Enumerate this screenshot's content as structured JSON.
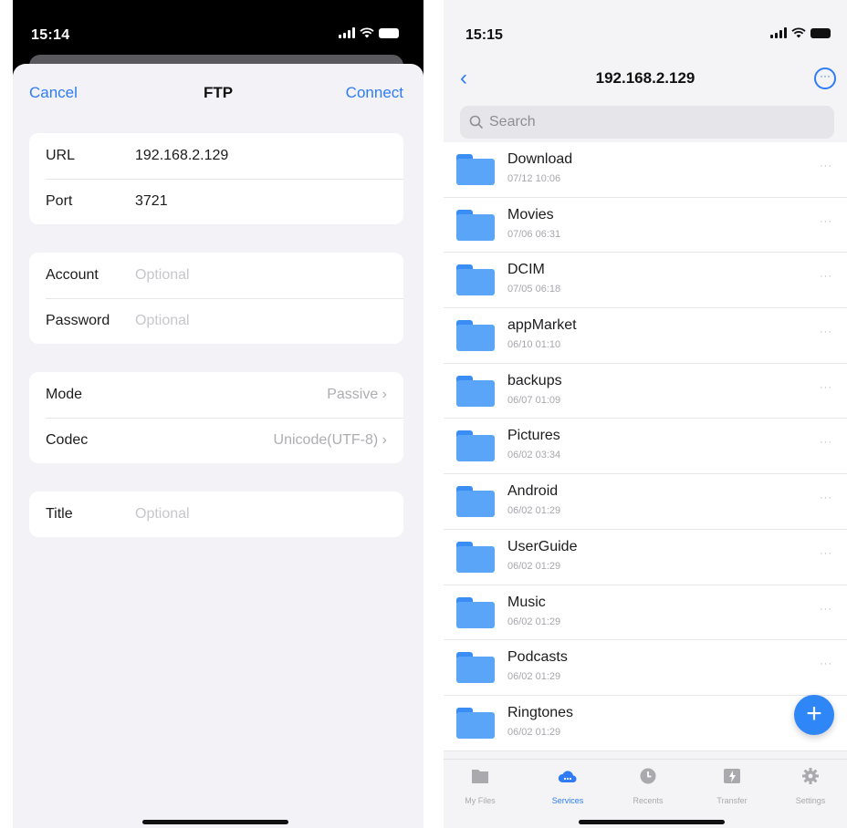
{
  "left": {
    "status_time": "15:14",
    "nav": {
      "cancel_label": "Cancel",
      "title": "FTP",
      "connect_label": "Connect"
    },
    "server_group": {
      "url_label": "URL",
      "url_value": "192.168.2.129",
      "port_label": "Port",
      "port_value": "3721"
    },
    "auth_group": {
      "account_label": "Account",
      "account_placeholder": "Optional",
      "password_label": "Password",
      "password_placeholder": "Optional"
    },
    "options_group": {
      "mode_label": "Mode",
      "mode_value": "Passive ›",
      "codec_label": "Codec",
      "codec_value": "Unicode(UTF-8) ›"
    },
    "title_group": {
      "title_label": "Title",
      "title_placeholder": "Optional"
    }
  },
  "right": {
    "status_time": "15:15",
    "nav": {
      "back_icon": "‹",
      "title": "192.168.2.129",
      "more_icon": "···"
    },
    "search": {
      "icon": "Q",
      "placeholder": "Search"
    },
    "items": [
      {
        "name": "Download",
        "date": "07/12 10:06"
      },
      {
        "name": "Movies",
        "date": "07/06 06:31"
      },
      {
        "name": "DCIM",
        "date": "07/05 06:18"
      },
      {
        "name": "appMarket",
        "date": "06/10 01:10"
      },
      {
        "name": "backups",
        "date": "06/07 01:09"
      },
      {
        "name": "Pictures",
        "date": "06/02 03:34"
      },
      {
        "name": "Android",
        "date": "06/02 01:29"
      },
      {
        "name": "UserGuide",
        "date": "06/02 01:29"
      },
      {
        "name": "Music",
        "date": "06/02 01:29"
      },
      {
        "name": "Podcasts",
        "date": "06/02 01:29"
      },
      {
        "name": "Ringtones",
        "date": "06/02 01:29"
      }
    ],
    "item_more": "···",
    "fab_label": "+",
    "tabs": [
      {
        "label": "My Files",
        "icon": "folder-icon"
      },
      {
        "label": "Services",
        "icon": "cloud-icon"
      },
      {
        "label": "Recents",
        "icon": "clock-icon"
      },
      {
        "label": "Transfer",
        "icon": "transfer-icon"
      },
      {
        "label": "Settings",
        "icon": "gear-icon"
      }
    ]
  },
  "colors": {
    "accent": "#2f7cf6",
    "folder": "#5aa5f7",
    "sheet_bg": "#f2f2f7"
  }
}
